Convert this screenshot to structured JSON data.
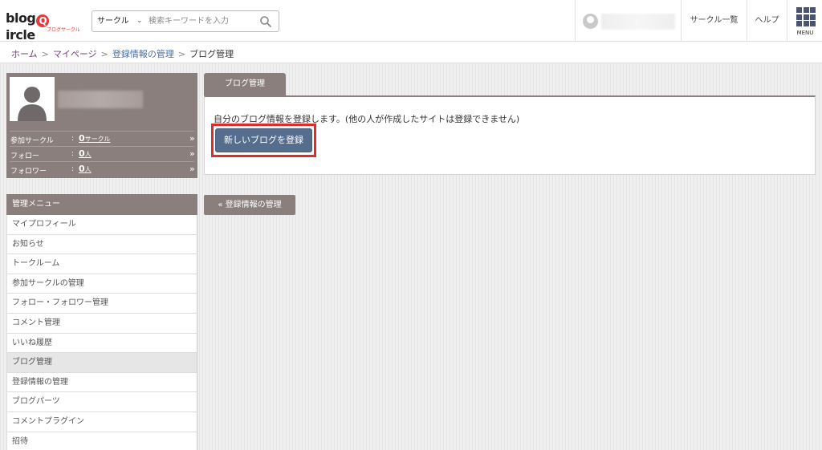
{
  "header": {
    "logo_text": "blogcircle",
    "logo_sub": "ブログサークル",
    "search_category": "サークル",
    "search_placeholder": "検索キーワードを入力",
    "links": {
      "circle_list": "サークル一覧",
      "help": "ヘルプ",
      "menu": "MENU"
    }
  },
  "breadcrumb": {
    "items": [
      "ホーム",
      "マイページ",
      "登録情報の管理",
      "ブログ管理"
    ],
    "separator": ">"
  },
  "profile": {
    "stats": [
      {
        "label": "参加サークル",
        "value": "0",
        "unit": "サークル"
      },
      {
        "label": "フォロー",
        "value": "0",
        "unit": "人"
      },
      {
        "label": "フォロワー",
        "value": "0",
        "unit": "人"
      }
    ]
  },
  "side_menu": {
    "title": "管理メニュー",
    "items": [
      "マイプロフィール",
      "お知らせ",
      "トークルーム",
      "参加サークルの管理",
      "フォロー・フォロワー管理",
      "コメント管理",
      "いいね履歴",
      "ブログ管理",
      "登録情報の管理",
      "ブログパーツ",
      "コメントプラグイン",
      "招待"
    ],
    "active_item": "ブログ管理"
  },
  "main": {
    "tab_label": "ブログ管理",
    "description": "自分のブログ情報を登録します。(他の人が作成したサイトは登録できません)",
    "primary_button": "新しいブログを登録",
    "back_button": "« 登録情報の管理"
  },
  "colors": {
    "panel_brown": "#8a7f7d",
    "button_blue": "#566e8e",
    "highlight_red": "#e22a2a",
    "crumb_link": "#7a3e82",
    "menu_icon": "#4a5470"
  }
}
